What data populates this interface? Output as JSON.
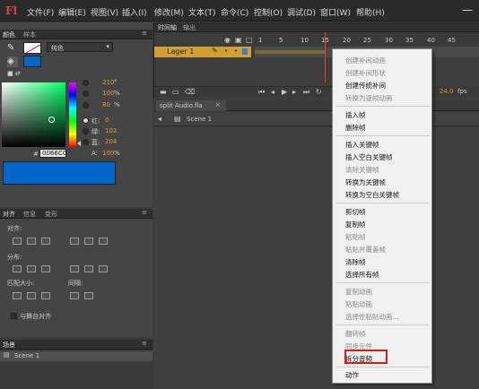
{
  "app": {
    "logo": "Fl"
  },
  "menubar": {
    "items": [
      "文件(F)",
      "编辑(E)",
      "视图(V)",
      "插入(I)",
      "修改(M)",
      "文本(T)",
      "命令(C)",
      "控制(O)",
      "调试(D)",
      "窗口(W)",
      "帮助(H)"
    ]
  },
  "color_panel": {
    "tabs": [
      "颜色",
      "样本"
    ],
    "fill_type": "纯色",
    "hsb": {
      "h": "210",
      "h_unit": "°",
      "s": "100",
      "s_unit": "%",
      "b": "80",
      "b_unit": "%"
    },
    "rgb": {
      "r_label": "红:",
      "r": "0",
      "g_label": "绿:",
      "g": "102",
      "b_label": "蓝:",
      "b": "204"
    },
    "alpha_label": "A:",
    "alpha": "100",
    "alpha_unit": "%",
    "hex_prefix": "#",
    "hex": "0066CC",
    "fill_color": "#0066cc"
  },
  "align_panel": {
    "tabs": [
      "对齐",
      "信息",
      "变形"
    ],
    "align_label": "对齐:",
    "distribute_label": "分布:",
    "match_size_label": "匹配大小:",
    "spacing_label": "间隔:",
    "stage_checkbox_label": "与舞台对齐"
  },
  "scene_panel": {
    "tab": "场景",
    "items": [
      "Scene 1"
    ]
  },
  "timeline": {
    "tabs": [
      "时间轴",
      "输出"
    ],
    "layer_name": "Lager 1",
    "ticks": [
      "1",
      "5",
      "10",
      "15",
      "20",
      "25",
      "30",
      "35",
      "40",
      "45"
    ],
    "fps": "24.0",
    "fps_unit": "fps"
  },
  "document": {
    "tab": "split Audio.fla",
    "scene": "Scene 1"
  },
  "context_menu": {
    "items": [
      {
        "label": "创建补间动画",
        "enabled": false
      },
      {
        "label": "创建补间形状",
        "enabled": false
      },
      {
        "label": "创建传统补间",
        "enabled": true
      },
      {
        "label": "转换为逐帧动画",
        "enabled": false
      },
      {
        "label": "插入帧",
        "enabled": true
      },
      {
        "label": "删除帧",
        "enabled": true
      },
      {
        "label": "插入关键帧",
        "enabled": true
      },
      {
        "label": "插入空白关键帧",
        "enabled": true
      },
      {
        "label": "清除关键帧",
        "enabled": false
      },
      {
        "label": "转换为关键帧",
        "enabled": true
      },
      {
        "label": "转换为空白关键帧",
        "enabled": true
      },
      {
        "label": "剪切帧",
        "enabled": true
      },
      {
        "label": "复制帧",
        "enabled": true
      },
      {
        "label": "粘贴帧",
        "enabled": false
      },
      {
        "label": "粘贴并覆盖帧",
        "enabled": false
      },
      {
        "label": "清除帧",
        "enabled": true
      },
      {
        "label": "选择所有帧",
        "enabled": true
      },
      {
        "label": "复制动画",
        "enabled": false
      },
      {
        "label": "粘贴动画",
        "enabled": false
      },
      {
        "label": "选择性粘贴动画...",
        "enabled": false
      },
      {
        "label": "翻转帧",
        "enabled": false
      },
      {
        "label": "同步元件",
        "enabled": false
      },
      {
        "label": "拆分音频",
        "enabled": true
      },
      {
        "label": "动作",
        "enabled": true
      }
    ],
    "highlight_color": "#d41a1a"
  }
}
